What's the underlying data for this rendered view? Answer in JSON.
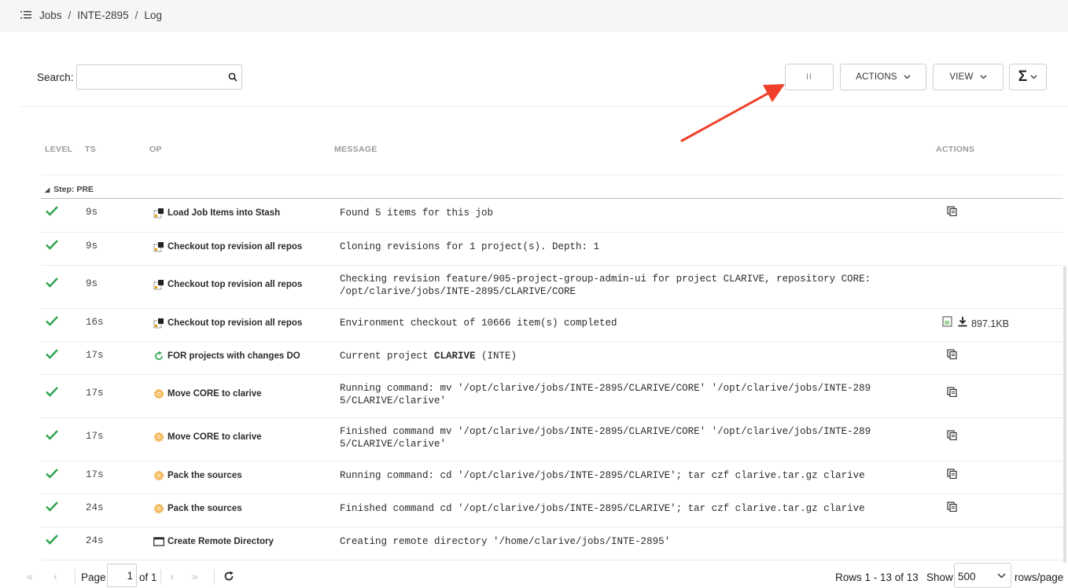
{
  "breadcrumb": {
    "items": [
      "Jobs",
      "INTE-2895",
      "Log"
    ]
  },
  "toolbar": {
    "search_label": "Search:",
    "search_value": "",
    "pause_label": "II",
    "actions_label": "ACTIONS",
    "view_label": "VIEW",
    "sum_label": "Σ"
  },
  "table": {
    "headers": {
      "level": "LEVEL",
      "ts": "TS",
      "op": "OP",
      "message": "MESSAGE",
      "actions": "ACTIONS"
    },
    "group_label": "Step: PRE",
    "rows": [
      {
        "ts": "9s",
        "op": "Load Job Items into Stash",
        "op_icon": "stash-icon",
        "msg": "Found 5 items for this job",
        "action": "copy-icon"
      },
      {
        "ts": "9s",
        "op": "Checkout top revision all repos",
        "op_icon": "stash-icon",
        "msg": "Cloning revisions for 1 project(s). Depth: 1",
        "action": ""
      },
      {
        "ts": "9s",
        "op": "Checkout top revision all repos",
        "op_icon": "stash-icon",
        "msg": "Checking revision feature/905-project-group-admin-ui for project CLARIVE, repository CORE: /opt/clarive/jobs/INTE-2895/CLARIVE/CORE",
        "action": ""
      },
      {
        "ts": "16s",
        "op": "Checkout top revision all repos",
        "op_icon": "stash-icon",
        "msg": "Environment checkout of 10666 item(s) completed",
        "action": "download",
        "size": "897.1KB"
      },
      {
        "ts": "17s",
        "op": "FOR projects with changes DO",
        "op_icon": "loop-icon",
        "msg_pre": "Current project ",
        "msg_bold": "CLARIVE",
        "msg_post": " (INTE)",
        "action": "copy-icon"
      },
      {
        "ts": "17s",
        "op": "Move CORE to clarive",
        "op_icon": "gear-icon",
        "msg": "Running command: mv '/opt/clarive/jobs/INTE-2895/CLARIVE/CORE' '/opt/clarive/jobs/INTE-2895/CLARIVE/clarive'",
        "action": "copy-icon"
      },
      {
        "ts": "17s",
        "op": "Move CORE to clarive",
        "op_icon": "gear-icon",
        "msg": "Finished command mv '/opt/clarive/jobs/INTE-2895/CLARIVE/CORE' '/opt/clarive/jobs/INTE-2895/CLARIVE/clarive'",
        "action": "copy-icon"
      },
      {
        "ts": "17s",
        "op": "Pack the sources",
        "op_icon": "gear-icon",
        "msg": "Running command: cd '/opt/clarive/jobs/INTE-2895/CLARIVE'; tar czf clarive.tar.gz clarive",
        "action": "copy-icon"
      },
      {
        "ts": "24s",
        "op": "Pack the sources",
        "op_icon": "gear-icon",
        "msg": "Finished command cd '/opt/clarive/jobs/INTE-2895/CLARIVE'; tar czf clarive.tar.gz clarive",
        "action": "copy-icon"
      },
      {
        "ts": "24s",
        "op": "Create Remote Directory",
        "op_icon": "window-icon",
        "msg": "Creating remote directory '/home/clarive/jobs/INTE-2895'",
        "action": ""
      }
    ]
  },
  "pager": {
    "page_label": "Page",
    "page_value": "1",
    "of_label": "of 1",
    "rows_info": "Rows 1 - 13 of 13",
    "show_label": "Show",
    "show_value": "500",
    "rows_page_label": "rows/page"
  },
  "colors": {
    "success": "#2ea44f",
    "gear": "#f0a020",
    "loop": "#3cae5a",
    "annotation_arrow": "#f0402a"
  }
}
